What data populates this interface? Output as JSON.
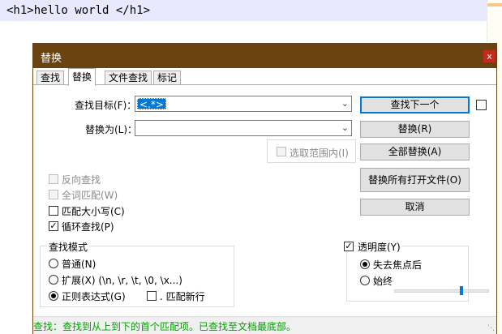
{
  "editor": {
    "line_text": "<h1>hello world </h1>"
  },
  "dialog": {
    "title": "替换",
    "close_label": "x",
    "tabs": [
      {
        "label": "查找",
        "active": false
      },
      {
        "label": "替换",
        "active": true
      },
      {
        "label": "文件查找",
        "active": false
      },
      {
        "label": "标记",
        "active": false
      }
    ],
    "find_label": "查找目标(F)：",
    "find_value": "<.*>",
    "replace_label": "替换为(L)：",
    "replace_value": "",
    "in_selection_label": "选取范围内(I)",
    "buttons": {
      "find_next": "查找下一个",
      "replace": "替换(R)",
      "replace_all": "全部替换(A)",
      "replace_all_open": "替换所有打开文件(O)",
      "cancel": "取消"
    },
    "options": {
      "backward": "反向查找",
      "whole_word": "全词匹配(W)",
      "match_case": "匹配大小写(C)",
      "wrap": "循环查找(P)"
    },
    "search_mode": {
      "title": "查找模式",
      "normal": "普通(N)",
      "extended": "扩展(X) (\\n, \\r, \\t, \\0, \\x...)",
      "regex": "正则表达式(G)",
      "dot_newline": ". 匹配新行"
    },
    "transparency": {
      "title": "透明度(Y)",
      "on_lose_focus": "失去焦点后",
      "always": "始终",
      "level": 0.72
    },
    "status_text": "查找：查找到从上到下的首个匹配项。已查找至文档最底部。"
  },
  "colors": {
    "titlebar": "#6b4310",
    "status_text": "#00a000",
    "accent": "#0078d7"
  }
}
